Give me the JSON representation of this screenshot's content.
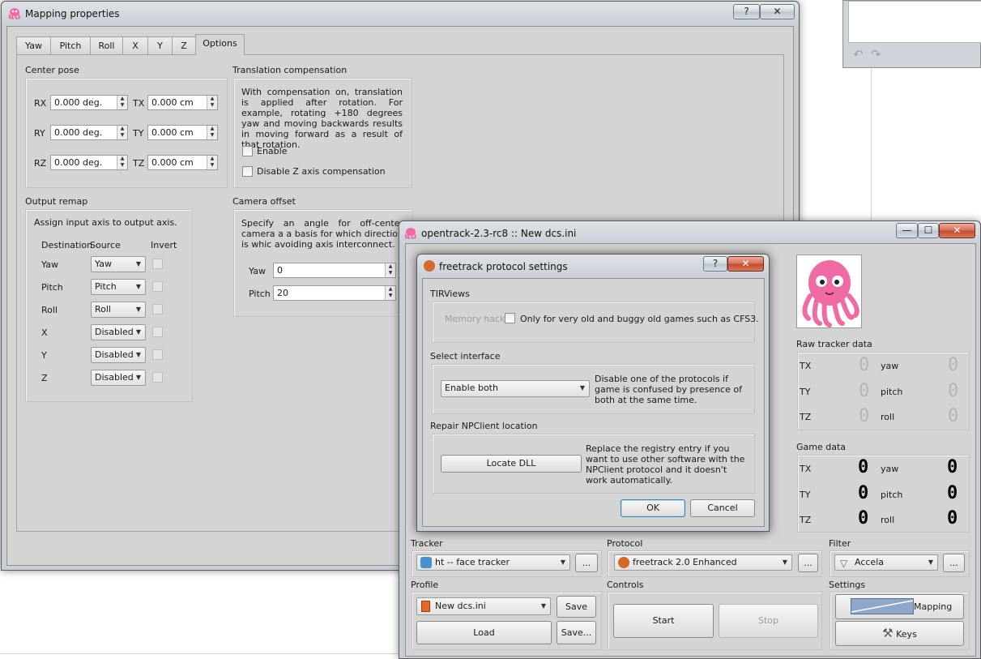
{
  "background_window": {
    "undo_icon": "undo-arrow-icon",
    "redo_icon": "redo-arrow-icon"
  },
  "mapping": {
    "title": "Mapping properties",
    "help_btn": "?",
    "close_btn": "✕",
    "tabs": [
      "Yaw",
      "Pitch",
      "Roll",
      "X",
      "Y",
      "Z",
      "Options"
    ],
    "center_pose": {
      "label": "Center pose",
      "rows": [
        {
          "rot": "RX",
          "rot_val": "0.000 deg.",
          "tr": "TX",
          "tr_val": "0.000 cm"
        },
        {
          "rot": "RY",
          "rot_val": "0.000 deg.",
          "tr": "TY",
          "tr_val": "0.000 cm"
        },
        {
          "rot": "RZ",
          "rot_val": "0.000 deg.",
          "tr": "TZ",
          "tr_val": "0.000 cm"
        }
      ]
    },
    "translation": {
      "label": "Translation compensation",
      "text": "With compensation on, translation is applied after rotation. For example, rotating +180 degrees yaw and moving backwards results in moving forward as a result of that rotation.",
      "enable": "Enable",
      "disable_z": "Disable Z axis compensation"
    },
    "output_remap": {
      "label": "Output remap",
      "hint": "Assign input axis to output axis.",
      "headers": {
        "dest": "Destination",
        "source": "Source",
        "invert": "Invert"
      },
      "rows": [
        {
          "dest": "Yaw",
          "source": "Yaw"
        },
        {
          "dest": "Pitch",
          "source": "Pitch"
        },
        {
          "dest": "Roll",
          "source": "Roll"
        },
        {
          "dest": "X",
          "source": "Disabled"
        },
        {
          "dest": "Y",
          "source": "Disabled"
        },
        {
          "dest": "Z",
          "source": "Disabled"
        }
      ]
    },
    "camera_offset": {
      "label": "Camera offset",
      "text": "Specify an angle for off-center camera a a basis for which direction is whic avoiding axis interconnect.",
      "yaw_label": "Yaw",
      "yaw_val": "0",
      "pitch_label": "Pitch",
      "pitch_val": "20"
    }
  },
  "main": {
    "title": "opentrack-2.3-rc8 :: New dcs.ini",
    "min_btn": "—",
    "max_btn": "☐",
    "close_btn": "✕",
    "raw_tracker": {
      "label": "Raw tracker data",
      "rows": [
        {
          "l": "TX",
          "r": "yaw"
        },
        {
          "l": "TY",
          "r": "pitch"
        },
        {
          "l": "TZ",
          "r": "roll"
        }
      ],
      "value": "0"
    },
    "game_data": {
      "label": "Game data",
      "rows": [
        {
          "l": "TX",
          "r": "yaw"
        },
        {
          "l": "TY",
          "r": "pitch"
        },
        {
          "l": "TZ",
          "r": "roll"
        }
      ],
      "value": "0"
    },
    "tracker": {
      "label": "Tracker",
      "value": "ht -- face tracker",
      "more": "..."
    },
    "protocol": {
      "label": "Protocol",
      "value": "freetrack 2.0 Enhanced",
      "more": "..."
    },
    "filter": {
      "label": "Filter",
      "value": "Accela",
      "more": "..."
    },
    "profile": {
      "label": "Profile",
      "value": "New dcs.ini",
      "save": "Save",
      "load": "Load",
      "save_as": "Save..."
    },
    "controls": {
      "label": "Controls",
      "start": "Start",
      "stop": "Stop"
    },
    "settings": {
      "label": "Settings",
      "mapping": "Mapping",
      "keys": "Keys"
    }
  },
  "freetrack": {
    "title": "freetrack protocol settings",
    "help_btn": "?",
    "close_btn": "✕",
    "tirviews": {
      "label": "TIRViews",
      "memory": "Memory hacks",
      "note": "Only for very old and buggy old games such as CFS3."
    },
    "interface": {
      "label": "Select interface",
      "value": "Enable both",
      "note": "Disable one of the protocols if game is confused by presence of both at the same time."
    },
    "repair": {
      "label": "Repair NPClient location",
      "button": "Locate DLL",
      "note": "Replace the registry entry if you want to use other software with the NPClient protocol and it doesn't work automatically."
    },
    "ok": "OK",
    "cancel": "Cancel"
  },
  "colors": {
    "octopus": "#f06aa4",
    "dialog_bg": "#d4d4d4",
    "close_red": "#c7482c"
  }
}
